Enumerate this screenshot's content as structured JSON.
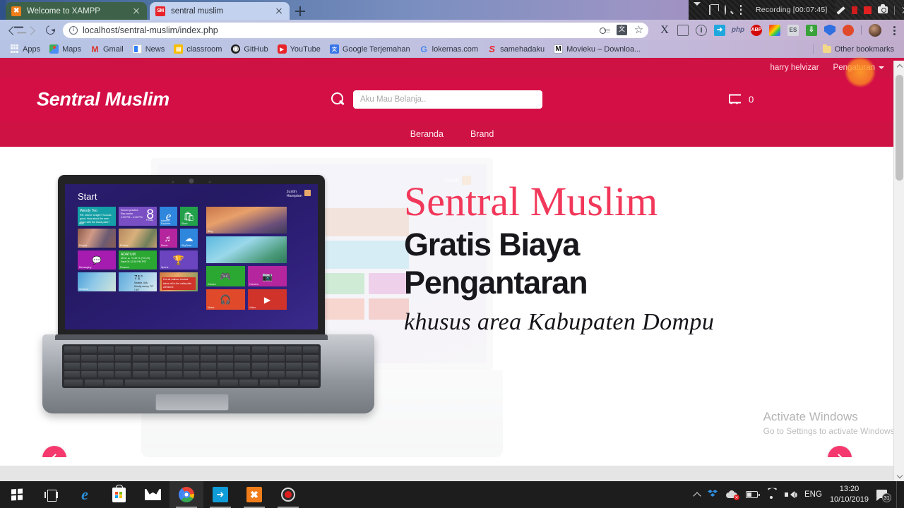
{
  "browser": {
    "tabs": [
      {
        "title": "Welcome to XAMPP",
        "favicon": "xampp-favicon",
        "active": false
      },
      {
        "title": "sentral muslim",
        "favicon": "sm-favicon",
        "active": true
      }
    ],
    "new_tab_label": "+",
    "url_display": "localhost/sentral-muslim/index.php",
    "url_host": "localhost",
    "url_path": "/sentral-muslim/index.php",
    "bookmarks": [
      {
        "label": "Apps",
        "icon": "apps-grid-icon"
      },
      {
        "label": "Maps",
        "icon": "google-maps-icon"
      },
      {
        "label": "Gmail",
        "icon": "gmail-icon"
      },
      {
        "label": "News",
        "icon": "google-news-icon"
      },
      {
        "label": "classroom",
        "icon": "google-classroom-icon"
      },
      {
        "label": "GitHub",
        "icon": "github-icon"
      },
      {
        "label": "YouTube",
        "icon": "youtube-icon"
      },
      {
        "label": "Google Terjemahan",
        "icon": "google-translate-icon"
      },
      {
        "label": "lokernas.com",
        "icon": "google-favicon"
      },
      {
        "label": "samehadaku",
        "icon": "samehadaku-icon"
      },
      {
        "label": "Movieku – Downloa...",
        "icon": "movieku-icon"
      }
    ],
    "other_bookmarks_label": "Other bookmarks",
    "extensions": [
      {
        "name": "x-extension"
      },
      {
        "name": "box-extension"
      },
      {
        "name": "circle-extension"
      },
      {
        "name": "blue-arrow-extension"
      },
      {
        "name": "php-extension",
        "label": "php"
      },
      {
        "name": "adblock-extension",
        "label": "ABP"
      },
      {
        "name": "rainbow-extension"
      },
      {
        "name": "es-extension",
        "label": "ES"
      },
      {
        "name": "green-download-extension"
      },
      {
        "name": "shield-extension"
      },
      {
        "name": "tomato-timer-extension"
      }
    ]
  },
  "recorder": {
    "status_label": "Recording [00:07:45]",
    "controls": [
      "caret-down-icon",
      "window-icon",
      "magnifier-icon",
      "crop-icon",
      "pencil-icon",
      "pause-icon",
      "stop-icon",
      "camera-icon",
      "close-icon"
    ]
  },
  "site": {
    "topbar": {
      "username": "harry helvizar",
      "settings_label": "Pengaturan"
    },
    "brand": "Sentral Muslim",
    "search": {
      "placeholder": "Aku Mau Belanja..",
      "value": ""
    },
    "cart": {
      "count": "0"
    },
    "nav": [
      {
        "label": "Beranda"
      },
      {
        "label": "Brand"
      }
    ],
    "hero": {
      "title": "Sentral Muslim",
      "subtitle_line1": "Gratis Biaya",
      "subtitle_line2": "Pengantaran",
      "note": "khusus area Kabupaten Dompu",
      "prev_label": "‹",
      "next_label": "›"
    },
    "laptop_screen": {
      "start_label": "Start",
      "user_name": "Justin",
      "user_sub": "Hampton",
      "calendar_day": "8",
      "calendar_sub": "Friday",
      "mail_sender": "Wendy Teo",
      "mail_preview": "RE: Dinner tonight? Sounds good. How about the new place with the black patio?",
      "mail_label": "Mail",
      "calendar_title": "Soccer practice",
      "calendar_place": "Rec center",
      "calendar_time": "1:00 PM – 4:00 PM",
      "tiles": [
        {
          "label": "Mail"
        },
        {
          "label": "Calendar"
        },
        {
          "label": "Internet Explorer"
        },
        {
          "label": "Store"
        },
        {
          "label": "Bing"
        },
        {
          "label": "People"
        },
        {
          "label": "Photos"
        },
        {
          "label": "Music"
        },
        {
          "label": "SkyDrive"
        },
        {
          "label": "Messaging"
        },
        {
          "label": "Finance"
        },
        {
          "label": "Sports"
        },
        {
          "label": "Games"
        },
        {
          "label": "Camera"
        },
        {
          "label": "Weather"
        },
        {
          "label": "News"
        },
        {
          "label": "Music"
        },
        {
          "label": "Video"
        }
      ],
      "finance_title": "ADATUM",
      "finance_value": "45.11 ▲ +0.32 % (+0.1%)",
      "finance_time": "Sept 08 12:30 PM PST",
      "weather_temp": "71°",
      "weather_city": "Seattle, WA",
      "weather_desc": "Mostly sunny 72° / 54°",
      "news_text": "Hot air balloon festival takes off in the valley this weekend"
    }
  },
  "windows": {
    "watermark_title": "Activate Windows",
    "watermark_sub": "Go to Settings to activate Windows.",
    "taskbar": {
      "items": [
        {
          "name": "start-button",
          "icon": "windows-logo-icon"
        },
        {
          "name": "task-view-button",
          "icon": "task-view-icon"
        },
        {
          "name": "edge-button",
          "icon": "edge-icon"
        },
        {
          "name": "store-button",
          "icon": "microsoft-store-icon"
        },
        {
          "name": "mail-button",
          "icon": "mail-icon"
        },
        {
          "name": "chrome-button",
          "icon": "chrome-icon"
        },
        {
          "name": "blue-app-button",
          "icon": "blue-app-icon"
        },
        {
          "name": "xampp-button",
          "icon": "xampp-icon"
        },
        {
          "name": "recorder-button",
          "icon": "record-icon"
        }
      ]
    },
    "tray": {
      "language": "ENG",
      "time": "13:20",
      "date": "10/10/2019",
      "notification_count": "31",
      "icons": [
        "chevron-up-icon",
        "dropbox-icon",
        "onedrive-error-icon",
        "battery-icon",
        "wifi-icon",
        "volume-icon"
      ]
    }
  },
  "colors": {
    "brand_red": "#d40f46",
    "brand_red_dark": "#cf1244",
    "hero_title_red": "#f2385a",
    "carousel_pink": "#f5396f"
  }
}
